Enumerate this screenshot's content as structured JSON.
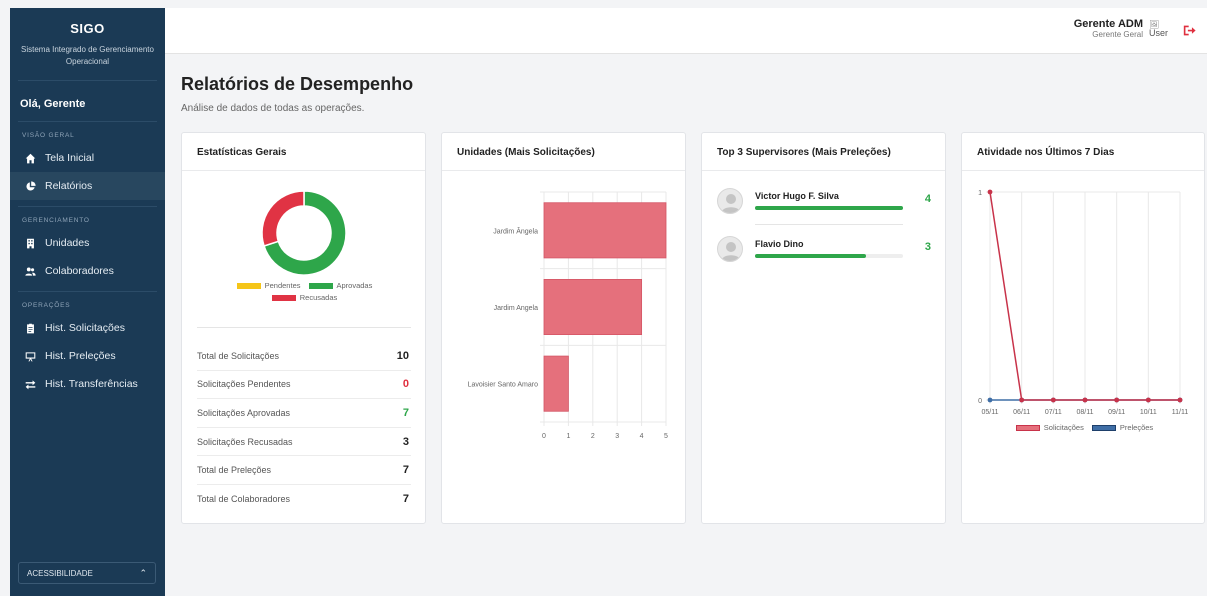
{
  "app": {
    "logo": "SIGO",
    "subtitle": "Sistema Integrado de Gerenciamento Operacional",
    "greeting": "Olá, Gerente"
  },
  "sidebar": {
    "sections": [
      {
        "title": "VISÃO GERAL",
        "items": [
          {
            "label": "Tela Inicial",
            "icon": "home-icon",
            "active": false
          },
          {
            "label": "Relatórios",
            "icon": "pie-chart-icon",
            "active": true
          }
        ]
      },
      {
        "title": "GERENCIAMENTO",
        "items": [
          {
            "label": "Unidades",
            "icon": "building-icon",
            "active": false
          },
          {
            "label": "Colaboradores",
            "icon": "users-icon",
            "active": false
          }
        ]
      },
      {
        "title": "OPERAÇÕES",
        "items": [
          {
            "label": "Hist. Solicitações",
            "icon": "clipboard-icon",
            "active": false
          },
          {
            "label": "Hist. Preleções",
            "icon": "presentation-icon",
            "active": false
          },
          {
            "label": "Hist. Transferências",
            "icon": "transfer-icon",
            "active": false
          }
        ]
      }
    ],
    "accessibility_label": "ACESSIBILIDADE"
  },
  "header": {
    "user_name": "Gerente ADM",
    "user_role": "Gerente Geral",
    "avatar_alt": "User"
  },
  "page": {
    "title": "Relatórios de Desempenho",
    "subtitle": "Análise de dados de todas as operações."
  },
  "cards": {
    "stats_title": "Estatísticas Gerais",
    "units_title": "Unidades (Mais Solicitações)",
    "supervisors_title": "Top 3 Supervisores (Mais Preleções)",
    "activity_title": "Atividade nos Últimos 7 Dias"
  },
  "stats": [
    {
      "label": "Total de Solicitações",
      "value": "10",
      "color": "#222222"
    },
    {
      "label": "Solicitações Pendentes",
      "value": "0",
      "color": "#e0303f"
    },
    {
      "label": "Solicitações Aprovadas",
      "value": "7",
      "color": "#2ea64a"
    },
    {
      "label": "Solicitações Recusadas",
      "value": "3",
      "color": "#222222"
    },
    {
      "label": "Total de Preleções",
      "value": "7",
      "color": "#222222"
    },
    {
      "label": "Total de Colaboradores",
      "value": "7",
      "color": "#222222"
    }
  ],
  "supervisors": [
    {
      "name": "Victor Hugo F. Silva",
      "count": "4",
      "progress": 1.0
    },
    {
      "name": "Flavio Dino",
      "count": "3",
      "progress": 0.75
    }
  ],
  "colors": {
    "pending": "#f5c518",
    "approved": "#2ea64a",
    "rejected": "#e03344",
    "bar": "#e5707c",
    "line": "#c8334a",
    "prelecao": "#3f6ea6"
  },
  "chart_data": [
    {
      "type": "pie",
      "variant": "donut",
      "title": "",
      "labels": [
        "Pendentes",
        "Aprovadas",
        "Recusadas"
      ],
      "values": [
        0,
        7,
        3
      ],
      "colors": [
        "#f5c518",
        "#2ea64a",
        "#e03344"
      ],
      "legend": "bottom"
    },
    {
      "type": "bar",
      "orientation": "horizontal",
      "categories": [
        "Jardim Ângela",
        "Jardim Angela",
        "Lavoisier Santo Amaro"
      ],
      "values": [
        5,
        4,
        1
      ],
      "xlim": [
        0,
        5
      ],
      "xticks": [
        "0",
        "1",
        "2",
        "3",
        "4",
        "5"
      ],
      "grid": true
    },
    {
      "type": "line",
      "x": [
        "05/11",
        "06/11",
        "07/11",
        "08/11",
        "09/11",
        "10/11",
        "11/11"
      ],
      "series": [
        {
          "name": "Solicitações",
          "values": [
            1,
            0,
            0,
            0,
            0,
            0,
            0
          ]
        },
        {
          "name": "Preleções",
          "values": [
            0,
            0,
            0,
            0,
            0,
            0,
            0
          ]
        }
      ],
      "ylim": [
        0,
        1
      ],
      "yticks": [
        "0",
        "1"
      ],
      "legend": "bottom",
      "grid": true
    }
  ]
}
